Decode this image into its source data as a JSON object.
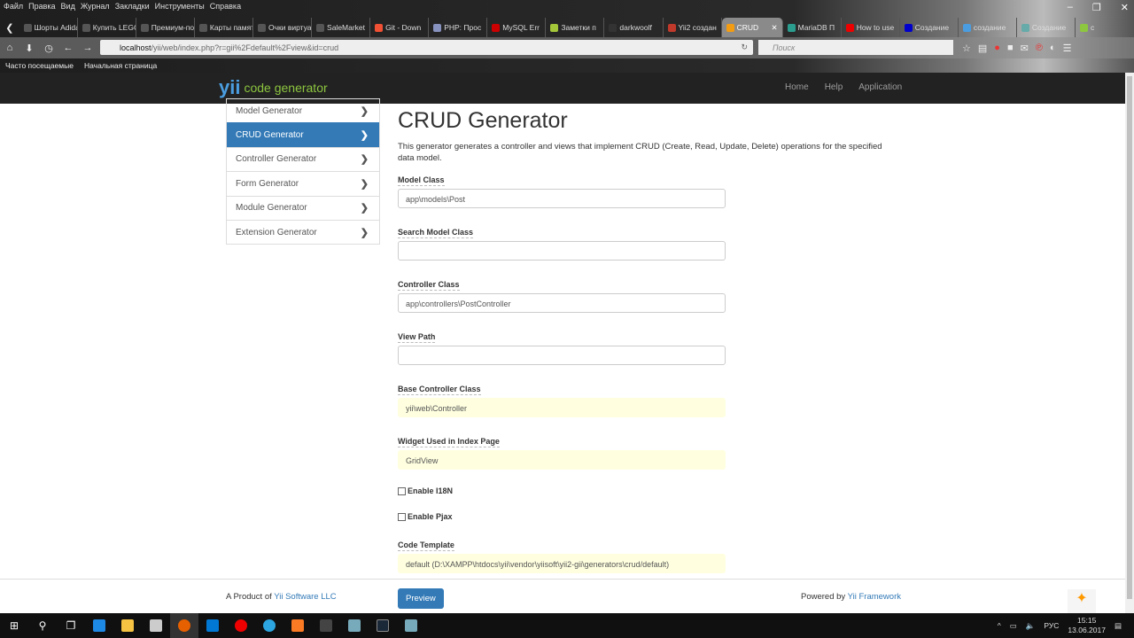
{
  "browser": {
    "menu": [
      "Файл",
      "Правка",
      "Вид",
      "Журнал",
      "Закладки",
      "Инструменты",
      "Справка"
    ],
    "tabs": [
      {
        "label": "Шорты Adidas",
        "color": "#555"
      },
      {
        "label": "Купить LEGO",
        "color": "#555"
      },
      {
        "label": "Премиум-под",
        "color": "#555"
      },
      {
        "label": "Карты памяти",
        "color": "#555"
      },
      {
        "label": "Очки виртуал",
        "color": "#555"
      },
      {
        "label": "SaleMarket",
        "color": "#555"
      },
      {
        "label": "Git - Down",
        "color": "#f05033"
      },
      {
        "label": "PHP: Проc",
        "color": "#8892bf"
      },
      {
        "label": "MySQL Err",
        "color": "#c00"
      },
      {
        "label": "Заметки п",
        "color": "#a4c639"
      },
      {
        "label": "darkwoolf",
        "color": "#333"
      },
      {
        "label": "Yii2 создан",
        "color": "#c0392b"
      },
      {
        "label": "CRUD",
        "color": "#f39c12",
        "active": true
      },
      {
        "label": "MariaDB П",
        "color": "#2a9d8f"
      },
      {
        "label": "How to use",
        "color": "#e00"
      },
      {
        "label": "Создание",
        "color": "#00c"
      },
      {
        "label": "создание",
        "color": "#4a9de0"
      },
      {
        "label": "Создание",
        "color": "#6aa"
      },
      {
        "label": "с",
        "color": "#8dc63f"
      }
    ],
    "url_host": "localhost",
    "url_path": "/yii/web/index.php?r=gii%2Fdefault%2Fview&id=crud",
    "search_placeholder": "Поиск",
    "bookmarks": [
      "Часто посещаемые",
      "Начальная страница"
    ]
  },
  "app": {
    "logo_text": "code generator",
    "logo_mark": "yii",
    "nav": [
      "Home",
      "Help",
      "Application"
    ],
    "sidebar": [
      {
        "label": "Model Generator"
      },
      {
        "label": "CRUD Generator",
        "active": true
      },
      {
        "label": "Controller Generator"
      },
      {
        "label": "Form Generator"
      },
      {
        "label": "Module Generator"
      },
      {
        "label": "Extension Generator"
      }
    ],
    "title": "CRUD Generator",
    "description": "This generator generates a controller and views that implement CRUD (Create, Read, Update, Delete) operations for the specified data model.",
    "fields": [
      {
        "label": "Model Class",
        "value": "app\\models\\Post"
      },
      {
        "label": "Search Model Class",
        "value": ""
      },
      {
        "label": "Controller Class",
        "value": "app\\controllers\\PostController"
      },
      {
        "label": "View Path",
        "value": ""
      },
      {
        "label": "Base Controller Class",
        "value": "yii\\web\\Controller",
        "sticky": true
      },
      {
        "label": "Widget Used in Index Page",
        "value": "GridView",
        "sticky": true
      }
    ],
    "checkboxes": [
      {
        "label": "Enable I18N",
        "checked": false
      },
      {
        "label": "Enable Pjax",
        "checked": false
      }
    ],
    "template": {
      "label": "Code Template",
      "value": "default (D:\\XAMPP\\htdocs\\yii\\vendor\\yiisoft\\yii2-gii\\generators\\crud/default)"
    },
    "preview_label": "Preview",
    "footer": {
      "left_prefix": "A Product of ",
      "left_link": "Yii Software LLC",
      "right_prefix": "Powered by ",
      "right_link": "Yii Framework"
    }
  },
  "taskbar": {
    "lang": "РУС",
    "time": "15:15",
    "date": "13.06.2017"
  },
  "colors": {
    "primary": "#337ab7",
    "navbar": "#222222",
    "sticky": "#ffffe0"
  }
}
